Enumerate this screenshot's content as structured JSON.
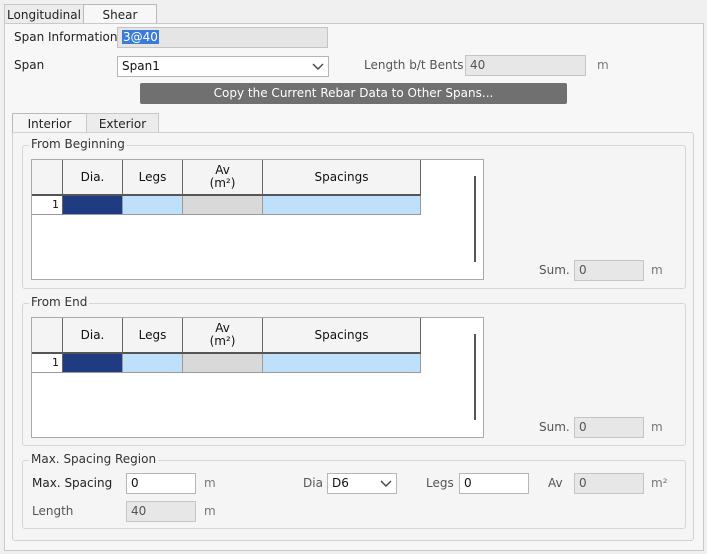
{
  "tabs": [
    {
      "label": "Longitudinal",
      "active": false
    },
    {
      "label": "Shear",
      "active": true
    }
  ],
  "span_information": {
    "label": "Span Information",
    "value": "3@40"
  },
  "span": {
    "label": "Span",
    "selected": "Span1"
  },
  "length_bt_bents": {
    "label": "Length b/t Bents",
    "value": "40",
    "unit": "m"
  },
  "copy_button": {
    "label": "Copy the Current Rebar Data to Other Spans..."
  },
  "subtabs": [
    {
      "label": "Interior",
      "active": true
    },
    {
      "label": "Exterior",
      "active": false
    }
  ],
  "from_beginning": {
    "title": "From Beginning",
    "columns": [
      "Dia.",
      "Legs",
      "Av\n(m²)",
      "Spacings"
    ],
    "rows": [
      {
        "num": "1"
      }
    ],
    "sum_label": "Sum.",
    "sum_value": "0",
    "sum_unit": "m"
  },
  "from_end": {
    "title": "From End",
    "columns": [
      "Dia.",
      "Legs",
      "Av\n(m²)",
      "Spacings"
    ],
    "rows": [
      {
        "num": "1"
      }
    ],
    "sum_label": "Sum.",
    "sum_value": "0",
    "sum_unit": "m"
  },
  "max_spacing_region": {
    "title": "Max. Spacing Region",
    "max_spacing_label": "Max. Spacing",
    "max_spacing_value": "0",
    "max_spacing_unit": "m",
    "dia_label": "Dia",
    "dia_value": "D6",
    "legs_label": "Legs",
    "legs_value": "0",
    "av_label": "Av",
    "av_value": "0",
    "av_unit": "m²",
    "length_label": "Length",
    "length_value": "40",
    "length_unit": "m"
  },
  "colors": {
    "selected_cell": "#1f3b82",
    "editable_cell": "#bfe0fb",
    "readonly_cell": "#d9d9d9",
    "selection_highlight": "#3a7bd5"
  }
}
